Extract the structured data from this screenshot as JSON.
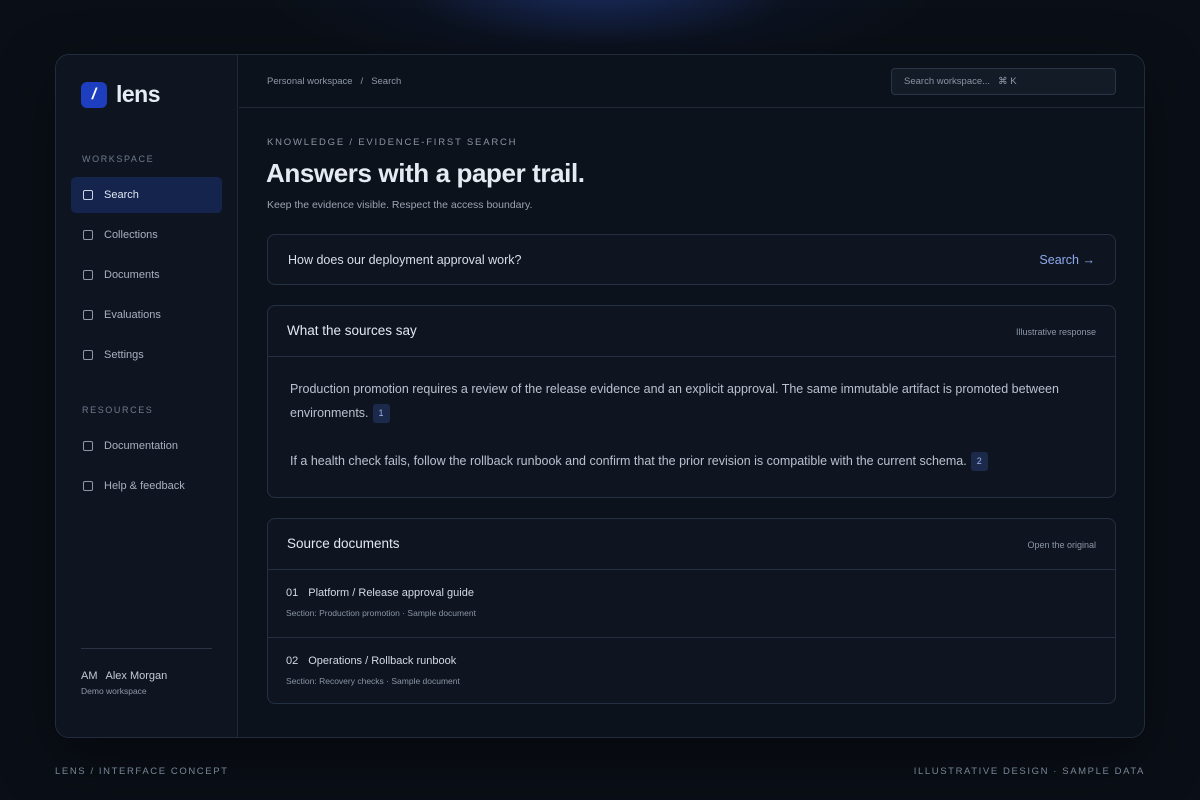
{
  "app": {
    "logo_mark": "/",
    "name": "lens"
  },
  "sidebar": {
    "workspace_label": "WORKSPACE",
    "workspace_items": [
      {
        "label": "Search",
        "icon": "square-icon",
        "active": true
      },
      {
        "label": "Collections",
        "icon": "square-icon"
      },
      {
        "label": "Documents",
        "icon": "square-icon"
      },
      {
        "label": "Evaluations",
        "icon": "square-icon"
      },
      {
        "label": "Settings",
        "icon": "square-icon"
      }
    ],
    "resources_label": "RESOURCES",
    "resource_items": [
      {
        "label": "Documentation",
        "icon": "square-icon"
      },
      {
        "label": "Help & feedback",
        "icon": "square-icon"
      }
    ],
    "user": {
      "initials": "AM",
      "name": "Alex Morgan",
      "workspace": "Demo workspace"
    }
  },
  "topbar": {
    "breadcrumb": [
      "Personal workspace",
      "/",
      "Search"
    ],
    "search_placeholder": "Search workspace...",
    "shortcut": "⌘ K"
  },
  "page": {
    "eyebrow": "KNOWLEDGE / EVIDENCE-FIRST SEARCH",
    "title": "Answers with a paper trail.",
    "subtitle": "Keep the evidence visible. Respect the access boundary."
  },
  "query": {
    "text": "How does our deployment approval work?",
    "action": "Search →"
  },
  "answer": {
    "title": "What the sources say",
    "meta": "Illustrative response",
    "paragraphs": [
      {
        "text": "Production promotion requires a review of the release evidence and an explicit approval. The same immutable artifact is promoted between environments.",
        "citation": "1"
      },
      {
        "text": "If a health check fails, follow the rollback runbook and confirm that the prior revision is compatible with the current schema.",
        "citation": "2"
      }
    ]
  },
  "sources": {
    "title": "Source documents",
    "meta": "Open the original",
    "items": [
      {
        "num": "01",
        "title": "Platform / Release approval guide",
        "sub": "Section: Production promotion · Sample document"
      },
      {
        "num": "02",
        "title": "Operations / Rollback runbook",
        "sub": "Section: Recovery checks · Sample document"
      }
    ]
  },
  "footer": {
    "left": "LENS / INTERFACE CONCEPT",
    "right": "ILLUSTRATIVE DESIGN · SAMPLE DATA"
  },
  "colors": {
    "accent": "#1d3fbf",
    "link": "#8fa9ef",
    "active_nav": "#14244d",
    "background": "#0a0f17"
  }
}
